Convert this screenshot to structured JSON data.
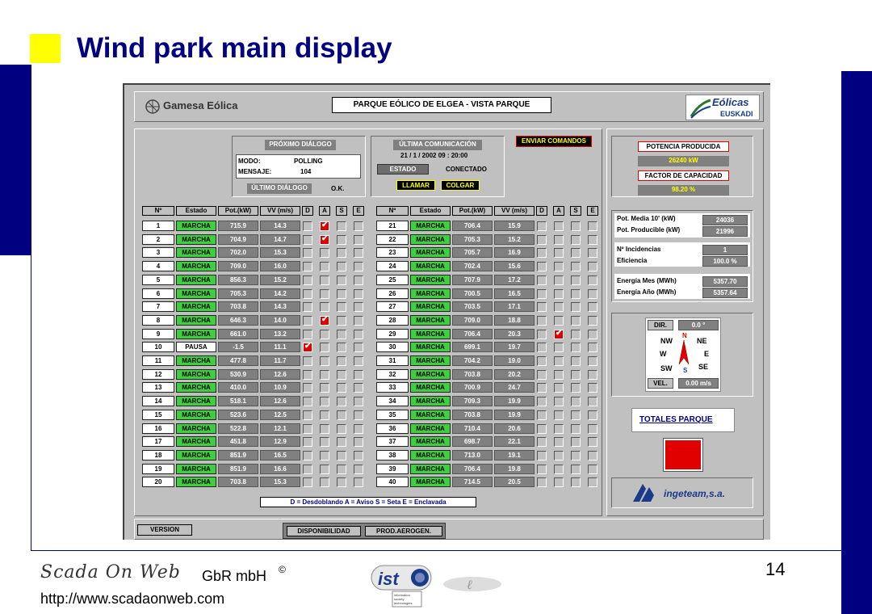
{
  "slide": {
    "title": "Wind park main display",
    "page_number": "14",
    "footer_brand": "Scada On Web",
    "footer_company": "GbR mbH",
    "footer_copyright": "©",
    "footer_url": "http://www.scadaonweb.com",
    "ist_logo_text": "ist",
    "ist_logo_sub": "information society technologies"
  },
  "scada": {
    "gamesa": "Gamesa Eólica",
    "header_title": "PARQUE EÓLICO DE ELGEA - VISTA PARQUE",
    "eolicas_line1": "Eólicas",
    "eolicas_line2": "EUSKADI",
    "proximo": {
      "title": "PRÓXIMO DIÁLOGO",
      "modo_label": "MODO:",
      "modo_value": "POLLING",
      "mensaje_label": "MENSAJE:",
      "mensaje_value": "104",
      "ultimo_label": "ÚLTIMO DIÁLOGO",
      "ultimo_value": "O.K."
    },
    "comm": {
      "title": "ÚLTIMA COMUNICACIÓN",
      "datetime": "21 / 1 / 2002 09 : 20:00",
      "estado_label": "ESTADO",
      "estado_value": "CONECTADO",
      "llamar": "LLAMAR",
      "colgar": "COLGAR"
    },
    "enviar": "ENVIAR COMANDOS",
    "headers": [
      "Nº",
      "Estado",
      "Pot.(kW)",
      "VV (m/s)",
      "D",
      "A",
      "S",
      "E"
    ],
    "turbines_left": [
      {
        "n": "1",
        "estado": "MARCHA",
        "pot": "715.9",
        "vv": "14.3",
        "d": false,
        "a": true
      },
      {
        "n": "2",
        "estado": "MARCHA",
        "pot": "704.9",
        "vv": "14.7",
        "d": false,
        "a": true
      },
      {
        "n": "3",
        "estado": "MARCHA",
        "pot": "702.0",
        "vv": "15.3",
        "d": false,
        "a": false
      },
      {
        "n": "4",
        "estado": "MARCHA",
        "pot": "709.0",
        "vv": "16.0",
        "d": false,
        "a": false
      },
      {
        "n": "5",
        "estado": "MARCHA",
        "pot": "856.3",
        "vv": "15.2",
        "d": false,
        "a": false
      },
      {
        "n": "6",
        "estado": "MARCHA",
        "pot": "705.3",
        "vv": "14.2",
        "d": false,
        "a": false
      },
      {
        "n": "7",
        "estado": "MARCHA",
        "pot": "703.8",
        "vv": "14.3",
        "d": false,
        "a": false
      },
      {
        "n": "8",
        "estado": "MARCHA",
        "pot": "646.3",
        "vv": "14.0",
        "d": false,
        "a": true
      },
      {
        "n": "9",
        "estado": "MARCHA",
        "pot": "661.0",
        "vv": "13.2",
        "d": false,
        "a": false
      },
      {
        "n": "10",
        "estado": "PAUSA",
        "pot": "-1.5",
        "vv": "11.1",
        "d": true,
        "a": false
      },
      {
        "n": "11",
        "estado": "MARCHA",
        "pot": "477.8",
        "vv": "11.7",
        "d": false,
        "a": false
      },
      {
        "n": "12",
        "estado": "MARCHA",
        "pot": "530.9",
        "vv": "12.6",
        "d": false,
        "a": false
      },
      {
        "n": "13",
        "estado": "MARCHA",
        "pot": "410.0",
        "vv": "10.9",
        "d": false,
        "a": false
      },
      {
        "n": "14",
        "estado": "MARCHA",
        "pot": "518.1",
        "vv": "12.6",
        "d": false,
        "a": false
      },
      {
        "n": "15",
        "estado": "MARCHA",
        "pot": "523.6",
        "vv": "12.5",
        "d": false,
        "a": false
      },
      {
        "n": "16",
        "estado": "MARCHA",
        "pot": "522.8",
        "vv": "12.1",
        "d": false,
        "a": false
      },
      {
        "n": "17",
        "estado": "MARCHA",
        "pot": "451.8",
        "vv": "12.9",
        "d": false,
        "a": false
      },
      {
        "n": "18",
        "estado": "MARCHA",
        "pot": "851.9",
        "vv": "16.5",
        "d": false,
        "a": false
      },
      {
        "n": "19",
        "estado": "MARCHA",
        "pot": "851.9",
        "vv": "16.6",
        "d": false,
        "a": false
      },
      {
        "n": "20",
        "estado": "MARCHA",
        "pot": "703.8",
        "vv": "15.3",
        "d": false,
        "a": false
      }
    ],
    "turbines_right": [
      {
        "n": "21",
        "estado": "MARCHA",
        "pot": "706.4",
        "vv": "15.9",
        "d": false,
        "a": false
      },
      {
        "n": "22",
        "estado": "MARCHA",
        "pot": "705.3",
        "vv": "15.2",
        "d": false,
        "a": false
      },
      {
        "n": "23",
        "estado": "MARCHA",
        "pot": "705.7",
        "vv": "16.9",
        "d": false,
        "a": false
      },
      {
        "n": "24",
        "estado": "MARCHA",
        "pot": "702.4",
        "vv": "15.6",
        "d": false,
        "a": false
      },
      {
        "n": "25",
        "estado": "MARCHA",
        "pot": "707.9",
        "vv": "17.2",
        "d": false,
        "a": false
      },
      {
        "n": "26",
        "estado": "MARCHA",
        "pot": "700.5",
        "vv": "16.5",
        "d": false,
        "a": false
      },
      {
        "n": "27",
        "estado": "MARCHA",
        "pot": "703.5",
        "vv": "17.1",
        "d": false,
        "a": false
      },
      {
        "n": "28",
        "estado": "MARCHA",
        "pot": "709.0",
        "vv": "18.8",
        "d": false,
        "a": false
      },
      {
        "n": "29",
        "estado": "MARCHA",
        "pot": "706.4",
        "vv": "20.3",
        "d": false,
        "a": true
      },
      {
        "n": "30",
        "estado": "MARCHA",
        "pot": "699.1",
        "vv": "19.7",
        "d": false,
        "a": false
      },
      {
        "n": "31",
        "estado": "MARCHA",
        "pot": "704.2",
        "vv": "19.0",
        "d": false,
        "a": false
      },
      {
        "n": "32",
        "estado": "MARCHA",
        "pot": "703.8",
        "vv": "20.2",
        "d": false,
        "a": false
      },
      {
        "n": "33",
        "estado": "MARCHA",
        "pot": "700.9",
        "vv": "24.7",
        "d": false,
        "a": false
      },
      {
        "n": "34",
        "estado": "MARCHA",
        "pot": "709.3",
        "vv": "19.9",
        "d": false,
        "a": false
      },
      {
        "n": "35",
        "estado": "MARCHA",
        "pot": "703.8",
        "vv": "19.9",
        "d": false,
        "a": false
      },
      {
        "n": "36",
        "estado": "MARCHA",
        "pot": "710.4",
        "vv": "20.6",
        "d": false,
        "a": false
      },
      {
        "n": "37",
        "estado": "MARCHA",
        "pot": "698.7",
        "vv": "22.1",
        "d": false,
        "a": false
      },
      {
        "n": "38",
        "estado": "MARCHA",
        "pot": "713.0",
        "vv": "19.1",
        "d": false,
        "a": false
      },
      {
        "n": "39",
        "estado": "MARCHA",
        "pot": "706.4",
        "vv": "19.8",
        "d": false,
        "a": false
      },
      {
        "n": "40",
        "estado": "MARCHA",
        "pot": "714.5",
        "vv": "20.5",
        "d": false,
        "a": false
      }
    ],
    "legend": "D = Desdoblando    A = Aviso    S = Seta    E = Enclavada",
    "potencia": {
      "label": "POTENCIA PRODUCIDA",
      "value": "26240  kW",
      "factor_label": "FACTOR DE CAPACIDAD",
      "factor_value": "98.20    %"
    },
    "stats": {
      "media_label": "Pot. Media 10'   (kW)",
      "media_value": "24036",
      "producible_label": "Pot. Producible (kW)",
      "producible_value": "21996",
      "incid_label": "Nº Incidencias",
      "incid_value": "1",
      "efic_label": "Eficiencia",
      "efic_value": "100.0 %",
      "mes_label": "Energía Mes (MWh)",
      "mes_value": "5357.70",
      "anio_label": "Energía Año (MWh)",
      "anio_value": "5357.64"
    },
    "wind": {
      "dir_label": "DIR.",
      "dir_value": "0.0  °",
      "vel_label": "VEL.",
      "vel_value": "0.00 m/s",
      "n": "N",
      "s": "S",
      "ne": "NE",
      "nw": "NW",
      "e": "E",
      "w": "W",
      "se": "SE",
      "sw": "SW"
    },
    "totales": "TOTALES PARQUE",
    "ingeteam": "ingeteam,s.a.",
    "version": "VERSION",
    "disponibilidad": "DISPONIBILIDAD",
    "prod": "PROD.AEROGEN."
  },
  "colors": {
    "navy": "#000080",
    "yellow": "#ffff00",
    "green": "#3ecf3e",
    "red": "#e00000",
    "panel": "#c0c0c0"
  }
}
